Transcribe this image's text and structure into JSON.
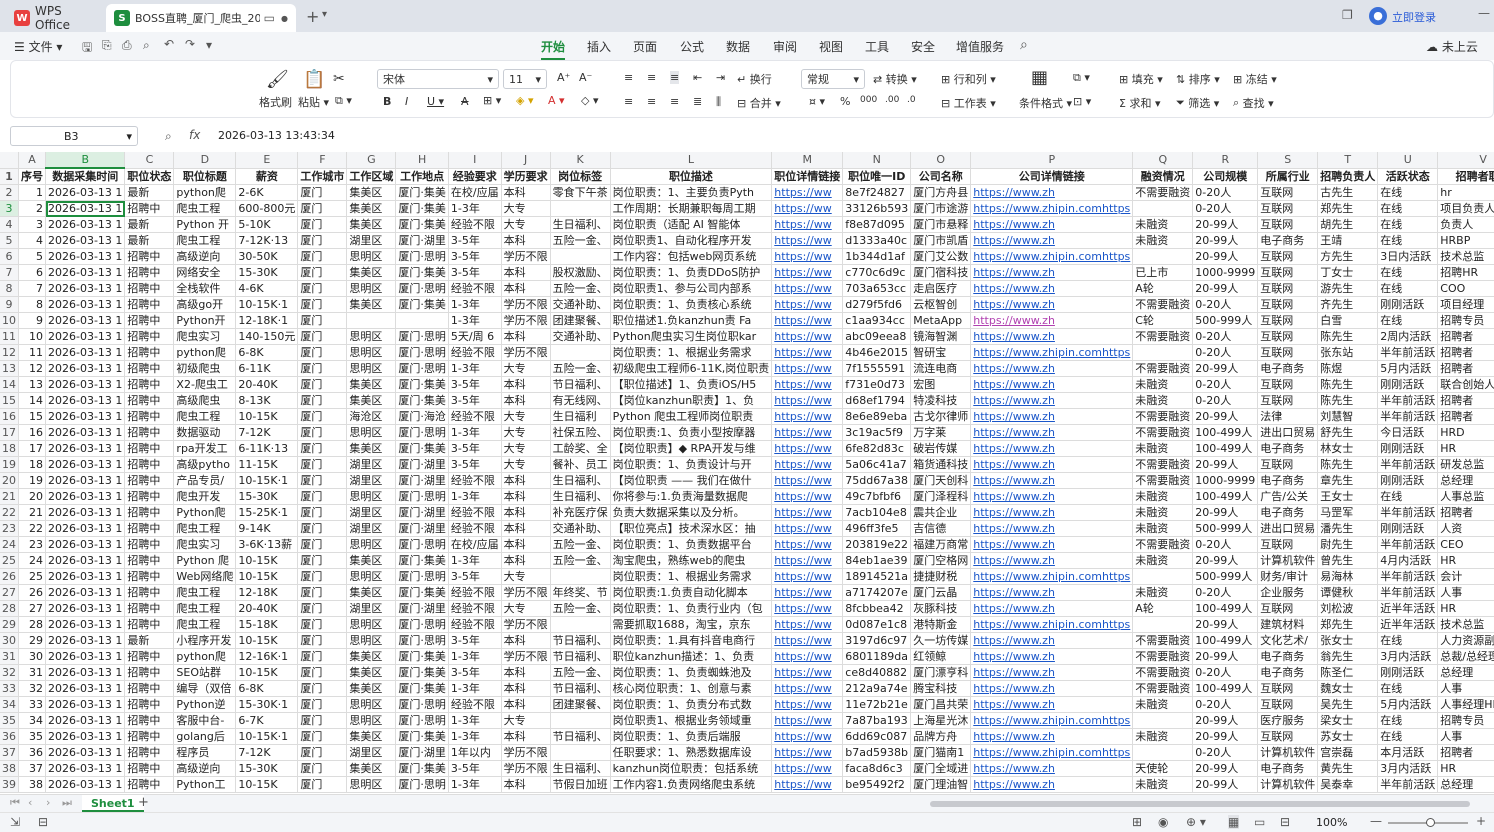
{
  "titlebar": {
    "app": "WPS Office",
    "doc_tab": "BOSS直聘_厦门_爬虫_20260",
    "login": "立即登录"
  },
  "menu": {
    "file": "文件",
    "items": [
      "开始",
      "插入",
      "页面",
      "公式",
      "数据",
      "审阅",
      "视图",
      "工具",
      "安全",
      "增值服务"
    ],
    "cloud": "未上云"
  },
  "ribbon": {
    "format_painter": "格式刷",
    "paste": "粘贴",
    "font": "宋体",
    "size": "11",
    "wrap": "换行",
    "merge": "合并",
    "number_format": "常规",
    "convert": "转换",
    "rowcol": "行和列",
    "worksheet": "工作表",
    "cond_format": "条件格式",
    "fill": "填充",
    "sort": "排序",
    "freeze": "冻结",
    "sum": "求和",
    "filter": "筛选",
    "find": "查找"
  },
  "formula": {
    "cell": "B3",
    "fx": "fx",
    "value": "2026-03-13 13:43:34"
  },
  "columns": [
    "A",
    "B",
    "C",
    "D",
    "E",
    "F",
    "G",
    "H",
    "I",
    "J",
    "K",
    "L",
    "M",
    "N",
    "O",
    "P",
    "Q",
    "R",
    "S",
    "T",
    "U",
    "V"
  ],
  "rows": [
    [
      "1",
      "序号",
      "数据采集时间",
      "职位状态",
      "职位标题",
      "薪资",
      "工作城市",
      "工作区域",
      "工作地点",
      "经验要求",
      "学历要求",
      "岗位标签",
      "职位描述",
      "职位详情链接",
      "职位唯一ID",
      "公司名称",
      "公司详情链接",
      "融资情况",
      "公司规模",
      "所属行业",
      "招聘负责人",
      "活跃状态",
      "招聘者职位"
    ],
    [
      "2",
      "1",
      "2026-03-13 1",
      "最新",
      "python爬",
      "2-6K",
      "厦门",
      "集美区",
      "厦门·集美",
      "在校/应届",
      "本科",
      "零食下午茶",
      "岗位职责：1、主要负责Pyth",
      "https://ww",
      "8e7f24827",
      "厦门方舟县",
      "https://www.zh",
      "不需要融资",
      "0-20人",
      "互联网",
      "古先生",
      "在线",
      "hr"
    ],
    [
      "3",
      "2",
      "2026-03-13 1",
      "招聘中",
      "爬虫工程",
      "600-800元",
      "厦门",
      "集美区",
      "厦门·集美",
      "1-3年",
      "大专",
      "",
      "工作周期：长期兼职每周工期",
      "https://ww",
      "33126b593",
      "厦门市途游",
      "https://www.zhipin.comhttps",
      "",
      "0-20人",
      "互联网",
      "郑先生",
      "在线",
      "项目负责人"
    ],
    [
      "4",
      "3",
      "2026-03-13 1",
      "最新",
      "Python 开",
      "5-10K",
      "厦门",
      "集美区",
      "厦门·集美",
      "经验不限",
      "大专",
      "生日福利、",
      "岗位职责（适配 AI 智能体",
      "https://ww",
      "f8e87d095",
      "厦门市悬释",
      "https://www.zh",
      "未融资",
      "20-99人",
      "互联网",
      "胡先生",
      "在线",
      "负责人"
    ],
    [
      "5",
      "4",
      "2026-03-13 1",
      "最新",
      "爬虫工程",
      "7-12K·13",
      "厦门",
      "湖里区",
      "厦门·湖里",
      "3-5年",
      "本科",
      "五险一金、",
      "岗位职责1、自动化程序开发",
      "https://ww",
      "d1333a40c",
      "厦门市凯盾",
      "https://www.zh",
      "未融资",
      "20-99人",
      "电子商务",
      "王靖",
      "在线",
      "HRBP"
    ],
    [
      "6",
      "5",
      "2026-03-13 1",
      "招聘中",
      "高级逆向",
      "30-50K",
      "厦门",
      "思明区",
      "厦门·思明",
      "3-5年",
      "学历不限",
      "",
      "工作内容：包括web网页系统",
      "https://ww",
      "1b344d1af",
      "厦门艾公数",
      "https://www.zhipin.comhttps",
      "",
      "20-99人",
      "互联网",
      "方先生",
      "3日内活跃",
      "技术总监"
    ],
    [
      "7",
      "6",
      "2026-03-13 1",
      "招聘中",
      "网络安全",
      "15-30K",
      "厦门",
      "集美区",
      "厦门·集美",
      "3-5年",
      "本科",
      "股权激励、",
      "岗位职责：1、负责DDoS防护",
      "https://ww",
      "c770c6d9c",
      "厦门宿科技",
      "https://www.zh",
      "已上市",
      "1000-9999",
      "互联网",
      "丁女士",
      "在线",
      "招聘HR"
    ],
    [
      "8",
      "7",
      "2026-03-13 1",
      "招聘中",
      "全栈软件",
      "4-6K",
      "厦门",
      "思明区",
      "厦门·思明",
      "经验不限",
      "本科",
      "五险一金、",
      "岗位职责1、参与公司内部系",
      "https://ww",
      "703a653cc",
      "走启医疗",
      "https://www.zh",
      "A轮",
      "20-99人",
      "互联网",
      "游先生",
      "在线",
      "COO"
    ],
    [
      "9",
      "8",
      "2026-03-13 1",
      "招聘中",
      "高级go开",
      "10-15K·1",
      "厦门",
      "集美区",
      "厦门·集美",
      "1-3年",
      "学历不限",
      "交通补助、",
      "岗位职责：1、负责核心系统",
      "https://ww",
      "d279f5fd6",
      "云枢智创",
      "https://www.zh",
      "不需要融资",
      "0-20人",
      "互联网",
      "齐先生",
      "刚刚活跃",
      "项目经理"
    ],
    [
      "10",
      "9",
      "2026-03-13 1",
      "招聘中",
      "Python开",
      "12-18K·1",
      "厦门",
      "",
      "",
      "1-3年",
      "学历不限",
      "团建聚餐、",
      "职位描述1.负kanzhun责 Fa",
      "https://ww",
      "c1aa934cc",
      "MetaApp",
      "https://www.zh",
      "C轮",
      "500-999人",
      "互联网",
      "白雪",
      "在线",
      "招聘专员"
    ],
    [
      "11",
      "10",
      "2026-03-13 1",
      "招聘中",
      "爬虫实习",
      "140-150元",
      "厦门",
      "思明区",
      "厦门·思明",
      "5天/周 6",
      "本科",
      "交通补助、",
      "Python爬虫实习生岗位职kar",
      "https://ww",
      "abc09eea8",
      "镜海智渊",
      "https://www.zh",
      "不需要融资",
      "0-20人",
      "互联网",
      "陈先生",
      "2周内活跃",
      "招聘者"
    ],
    [
      "12",
      "11",
      "2026-03-13 1",
      "招聘中",
      "python爬",
      "6-8K",
      "厦门",
      "思明区",
      "厦门·思明",
      "经验不限",
      "学历不限",
      "",
      "岗位职责：1、根据业务需求",
      "https://ww",
      "4b46e2015",
      "智研宝",
      "https://www.zhipin.comhttps",
      "",
      "0-20人",
      "互联网",
      "张东站",
      "半年前活跃",
      "招聘者"
    ],
    [
      "13",
      "12",
      "2026-03-13 1",
      "招聘中",
      "初级爬虫",
      "6-11K",
      "厦门",
      "思明区",
      "厦门·思明",
      "1-3年",
      "大专",
      "五险一金、",
      "初级爬虫工程师6-11K,岗位职责",
      "https://ww",
      "7f1555591",
      "流连电商",
      "https://www.zh",
      "不需要融资",
      "20-99人",
      "电子商务",
      "陈煜",
      "5月内活跃",
      "招聘者"
    ],
    [
      "14",
      "13",
      "2026-03-13 1",
      "招聘中",
      "X2-爬虫工",
      "20-40K",
      "厦门",
      "集美区",
      "厦门·集美",
      "3-5年",
      "本科",
      "节日福利、",
      "【职位描述】1、负责iOS/H5",
      "https://ww",
      "f731e0d73",
      "宏图",
      "https://www.zh",
      "未融资",
      "0-20人",
      "互联网",
      "陈先生",
      "刚刚活跃",
      "联合创始人"
    ],
    [
      "15",
      "14",
      "2026-03-13 1",
      "招聘中",
      "高级爬虫",
      "8-13K",
      "厦门",
      "集美区",
      "厦门·集美",
      "3-5年",
      "本科",
      "有无线网、",
      "【岗位kanzhun职责】1、负",
      "https://ww",
      "d68ef1794",
      "特凌科技",
      "https://www.zh",
      "未融资",
      "0-20人",
      "互联网",
      "陈先生",
      "半年前活跃",
      "招聘者"
    ],
    [
      "16",
      "15",
      "2026-03-13 1",
      "招聘中",
      "爬虫工程",
      "10-15K",
      "厦门",
      "海沧区",
      "厦门·海沧",
      "经验不限",
      "大专",
      "生日福利",
      "Python 爬虫工程师岗位职责",
      "https://ww",
      "8e6e89eba",
      "古戈尔律师",
      "https://www.zh",
      "不需要融资",
      "20-99人",
      "法律",
      "刘慧智",
      "半年前活跃",
      "招聘者"
    ],
    [
      "17",
      "16",
      "2026-03-13 1",
      "招聘中",
      "数据驱动",
      "7-12K",
      "厦门",
      "思明区",
      "厦门·思明",
      "1-3年",
      "大专",
      "社保五险、",
      "岗位职责:1、负责小型按摩器",
      "https://ww",
      "3c19ac5f9",
      "万字莱",
      "https://www.zh",
      "不需要融资",
      "100-499人",
      "进出口贸易",
      "舒先生",
      "今日活跃",
      "HRD"
    ],
    [
      "18",
      "17",
      "2026-03-13 1",
      "招聘中",
      "rpa开发工",
      "6-11K·13",
      "厦门",
      "集美区",
      "厦门·集美",
      "3-5年",
      "大专",
      "工龄奖、全",
      "【岗位职责】◆ RPA开发与维",
      "https://ww",
      "6fe82d83c",
      "破岩传媒",
      "https://www.zh",
      "未融资",
      "100-499人",
      "电子商务",
      "林女士",
      "刚刚活跃",
      "HR"
    ],
    [
      "19",
      "18",
      "2026-03-13 1",
      "招聘中",
      "高级pytho",
      "11-15K",
      "厦门",
      "湖里区",
      "厦门·湖里",
      "3-5年",
      "大专",
      "餐补、员工",
      "岗位职责：1、负责设计与开",
      "https://ww",
      "5a06c41a7",
      "箱货通科技",
      "https://www.zh",
      "不需要融资",
      "20-99人",
      "互联网",
      "陈先生",
      "半年前活跃",
      "研发总监"
    ],
    [
      "20",
      "19",
      "2026-03-13 1",
      "招聘中",
      "产品专员/",
      "10-15K·1",
      "厦门",
      "湖里区",
      "厦门·湖里",
      "经验不限",
      "本科",
      "生日福利、",
      "【岗位职责 —— 我们在做什",
      "https://ww",
      "75dd67a38",
      "厦门天创科",
      "https://www.zh",
      "不需要融资",
      "1000-9999",
      "电子商务",
      "章先生",
      "刚刚活跃",
      "总经理"
    ],
    [
      "21",
      "20",
      "2026-03-13 1",
      "招聘中",
      "爬虫开发",
      "15-30K",
      "厦门",
      "思明区",
      "厦门·思明",
      "1-3年",
      "本科",
      "生日福利、",
      "你将参与:1.负责海量数据爬",
      "https://ww",
      "49c7bfbf6",
      "厦门泽程科",
      "https://www.zh",
      "未融资",
      "100-499人",
      "广告/公关",
      "王女士",
      "在线",
      "人事总监"
    ],
    [
      "22",
      "21",
      "2026-03-13 1",
      "招聘中",
      "Python爬",
      "15-25K·1",
      "厦门",
      "湖里区",
      "厦门·湖里",
      "经验不限",
      "本科",
      "补充医疗保",
      "负责大数据采集以及分析。",
      "https://ww",
      "7acb104e8",
      "震共企业",
      "https://www.zh",
      "未融资",
      "20-99人",
      "电子商务",
      "马罡军",
      "半年前活跃",
      "招聘者"
    ],
    [
      "23",
      "22",
      "2026-03-13 1",
      "招聘中",
      "爬虫工程",
      "9-14K",
      "厦门",
      "湖里区",
      "厦门·湖里",
      "经验不限",
      "本科",
      "交通补助、",
      "【职位亮点】技术深水区：抽",
      "https://ww",
      "496ff3fe5",
      "吉信德",
      "https://www.zh",
      "未融资",
      "500-999人",
      "进出口贸易",
      "潘先生",
      "刚刚活跃",
      "人资"
    ],
    [
      "24",
      "23",
      "2026-03-13 1",
      "招聘中",
      "爬虫实习",
      "3-6K·13薪",
      "厦门",
      "思明区",
      "厦门·思明",
      "在校/应届",
      "本科",
      "五险一金、",
      "岗位职责：1、负责数据平台",
      "https://ww",
      "203819e22",
      "福建万商常",
      "https://www.zh",
      "不需要融资",
      "0-20人",
      "互联网",
      "尉先生",
      "半年前活跃",
      "CEO"
    ],
    [
      "25",
      "24",
      "2026-03-13 1",
      "招聘中",
      "Python 爬",
      "10-15K",
      "厦门",
      "集美区",
      "厦门·集美",
      "1-3年",
      "本科",
      "五险一金、",
      "淘宝爬虫，熟练web的爬虫",
      "https://ww",
      "84eb1ae39",
      "厦门空格网",
      "https://www.zh",
      "未融资",
      "20-99人",
      "计算机软件",
      "曾先生",
      "4月内活跃",
      "HR"
    ],
    [
      "26",
      "25",
      "2026-03-13 1",
      "招聘中",
      "Web网络爬",
      "10-15K",
      "厦门",
      "思明区",
      "厦门·思明",
      "3-5年",
      "大专",
      "",
      "岗位职责：1、根据业务需求",
      "https://ww",
      "18914521a",
      "捷捷财税",
      "https://www.zhipin.comhttps",
      "",
      "500-999人",
      "财务/审计",
      "易海林",
      "半年前活跃",
      "会计"
    ],
    [
      "27",
      "26",
      "2026-03-13 1",
      "招聘中",
      "爬虫工程",
      "12-18K",
      "厦门",
      "集美区",
      "厦门·集美",
      "经验不限",
      "学历不限",
      "年终奖、节",
      "岗位职责:1.负责自动化脚本",
      "https://ww",
      "a7174207e",
      "厦门云晶",
      "https://www.zh",
      "未融资",
      "0-20人",
      "企业服务",
      "谭健秋",
      "半年前活跃",
      "人事"
    ],
    [
      "28",
      "27",
      "2026-03-13 1",
      "招聘中",
      "爬虫工程",
      "20-40K",
      "厦门",
      "湖里区",
      "厦门·湖里",
      "经验不限",
      "大专",
      "五险一金、",
      "岗位职责：1、负责行业内（包",
      "https://ww",
      "8fcbbea42",
      "灰豚科技",
      "https://www.zh",
      "A轮",
      "100-499人",
      "互联网",
      "刘松波",
      "近半年活跃",
      "HR"
    ],
    [
      "29",
      "28",
      "2026-03-13 1",
      "招聘中",
      "爬虫工程",
      "15-18K",
      "厦门",
      "思明区",
      "厦门·思明",
      "经验不限",
      "学历不限",
      "",
      "需要抓取1688，淘宝，京东",
      "https://ww",
      "0d087e1c8",
      "港特斯金",
      "https://www.zhipin.comhttps",
      "",
      "20-99人",
      "建筑材料",
      "郑先生",
      "近半年活跃",
      "技术总监"
    ],
    [
      "30",
      "29",
      "2026-03-13 1",
      "最新",
      "小程序开发",
      "10-15K",
      "厦门",
      "思明区",
      "厦门·思明",
      "3-5年",
      "本科",
      "节日福利、",
      "岗位职责：1.具有抖音电商行",
      "https://ww",
      "3197d6c97",
      "久一坊传媒",
      "https://www.zh",
      "不需要融资",
      "100-499人",
      "文化艺术/",
      "张女士",
      "在线",
      "人力资源副总"
    ],
    [
      "31",
      "30",
      "2026-03-13 1",
      "招聘中",
      "python爬",
      "12-16K·1",
      "厦门",
      "集美区",
      "厦门·集美",
      "1-3年",
      "学历不限",
      "节日福利、",
      "职位kanzhun描述：1、负责",
      "https://ww",
      "6801189da",
      "红领鲸",
      "https://www.zh",
      "不需要融资",
      "20-99人",
      "电子商务",
      "翁先生",
      "3月内活跃",
      "总裁/总经理/CEO"
    ],
    [
      "32",
      "31",
      "2026-03-13 1",
      "招聘中",
      "SEO站群",
      "10-15K",
      "厦门",
      "集美区",
      "厦门·集美",
      "3-5年",
      "本科",
      "五险一金、",
      "岗位职责：1、负责蜘蛛池及",
      "https://ww",
      "ce8d40882",
      "厦门漂亨科",
      "https://www.zh",
      "不需要融资",
      "0-20人",
      "电子商务",
      "陈圣仁",
      "刚刚活跃",
      "总经理"
    ],
    [
      "33",
      "32",
      "2026-03-13 1",
      "招聘中",
      "编导（双倍",
      "6-8K",
      "厦门",
      "集美区",
      "厦门·集美",
      "1-3年",
      "本科",
      "节日福利、",
      "核心岗位职责：1、创意与素",
      "https://ww",
      "212a9a74e",
      "腾宝科技",
      "https://www.zh",
      "不需要融资",
      "100-499人",
      "互联网",
      "魏女士",
      "在线",
      "人事"
    ],
    [
      "34",
      "33",
      "2026-03-13 1",
      "招聘中",
      "Python逆",
      "15-30K·1",
      "厦门",
      "思明区",
      "厦门·思明",
      "经验不限",
      "本科",
      "团建聚餐、",
      "岗位职责：1、负责分布式数",
      "https://ww",
      "11e72b21e",
      "厦门昌共荣",
      "https://www.zh",
      "未融资",
      "0-20人",
      "互联网",
      "吴先生",
      "5月内活跃",
      "人事经理HR"
    ],
    [
      "35",
      "34",
      "2026-03-13 1",
      "招聘中",
      "客服中台-",
      "6-7K",
      "厦门",
      "思明区",
      "厦门·思明",
      "1-3年",
      "大专",
      "",
      "岗位职责1、根据业务领域重",
      "https://ww",
      "7a87ba193",
      "上海星光沐",
      "https://www.zhipin.comhttps",
      "",
      "20-99人",
      "医疗服务",
      "梁女士",
      "在线",
      "招聘专员"
    ],
    [
      "36",
      "35",
      "2026-03-13 1",
      "招聘中",
      "golang后",
      "10-15K·1",
      "厦门",
      "集美区",
      "厦门·集美",
      "1-3年",
      "本科",
      "节日福利、",
      "岗位职责：1、负责后端服",
      "https://ww",
      "6dd69c087",
      "品牌方舟",
      "https://www.zh",
      "未融资",
      "20-99人",
      "互联网",
      "苏女士",
      "在线",
      "人事"
    ],
    [
      "37",
      "36",
      "2026-03-13 1",
      "招聘中",
      "程序员",
      "7-12K",
      "厦门",
      "湖里区",
      "厦门·湖里",
      "1年以内",
      "学历不限",
      "",
      "任职要求：1、熟悉数据库设",
      "https://ww",
      "b7ad5938b",
      "厦门猫南1",
      "https://www.zhipin.comhttps",
      "",
      "0-20人",
      "计算机软件",
      "宫崇磊",
      "本月活跃",
      "招聘者"
    ],
    [
      "38",
      "37",
      "2026-03-13 1",
      "招聘中",
      "高级逆向",
      "15-30K",
      "厦门",
      "集美区",
      "厦门·集美",
      "3-5年",
      "学历不限",
      "生日福利、",
      "kanzhun岗位职责：包括系统",
      "https://ww",
      "faca8d6c3",
      "厦门全域进",
      "https://www.zh",
      "天使轮",
      "20-99人",
      "电子商务",
      "黄先生",
      "3月内活跃",
      "HR"
    ],
    [
      "39",
      "38",
      "2026-03-13 1",
      "招聘中",
      "Python工",
      "10-15K",
      "厦门",
      "思明区",
      "厦门·思明",
      "1-3年",
      "本科",
      "节假日加班",
      "工作内容1.负责网络爬虫系统",
      "https://ww",
      "be95492f2",
      "厦门理油智",
      "https://www.zh",
      "未融资",
      "20-99人",
      "计算机软件",
      "吴泰幸",
      "半年前活跃",
      "总经理"
    ]
  ],
  "sheet": {
    "name": "Sheet1"
  },
  "status": {
    "zoom": "100%"
  }
}
